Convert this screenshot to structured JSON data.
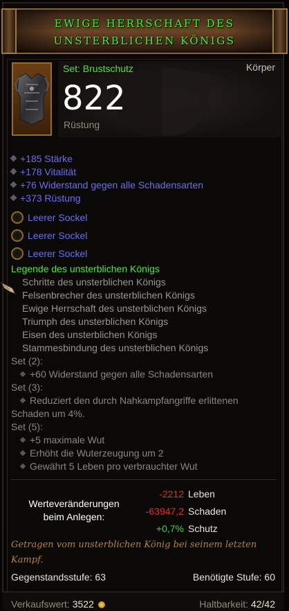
{
  "title": {
    "line1": "EWIGE HERRSCHAFT DES",
    "line2": "UNSTERBLICHEN KÖNIGS"
  },
  "item": {
    "type": "Set: Brustschutz",
    "slot": "Körper",
    "armor_value": "822",
    "armor_label": "Rüstung",
    "icon": "chest-armor-icon"
  },
  "stats": [
    "+185 Stärke",
    "+178 Vitalität",
    "+76 Widerstand gegen alle Schadensarten",
    "+373 Rüstung"
  ],
  "sockets": [
    "Leerer Sockel",
    "Leerer Sockel",
    "Leerer Sockel"
  ],
  "set": {
    "name": "Legende des unsterblichen Königs",
    "items": [
      "Schritte des unsterblichen Königs",
      "Felsenbrecher des unsterblichen Königs",
      "Ewige Herrschaft des unsterblichen Königs",
      "Triumph des unsterblichen Königs",
      "Eisen des unsterblichen Königs",
      "Stammesbindung des unsterblichen Königs"
    ],
    "bonus2_label": "Set (2):",
    "bonus2": [
      "+60 Widerstand gegen alle Schadensarten"
    ],
    "bonus3_label": "Set (3):",
    "bonus3_line1": "Reduziert den durch Nahkampfangriffe erlittenen",
    "bonus3_line2": "Schaden um 4%.",
    "bonus5_label": "Set (5):",
    "bonus5": [
      "+5 maximale Wut",
      "Erhöht die Wuterzeugung um 2",
      "Gewährt 5 Leben pro verbrauchter Wut"
    ]
  },
  "comparison": {
    "label_line1": "Werteveränderungen",
    "label_line2": "beim Anlegen:",
    "rows": [
      {
        "value": "-2212",
        "name": "Leben",
        "sign": "neg"
      },
      {
        "value": "-63947,2",
        "name": "Schaden",
        "sign": "neg"
      },
      {
        "value": "+0,7%",
        "name": "Schutz",
        "sign": "pos"
      }
    ],
    "colors": {
      "negative": "#e2312a",
      "positive": "#33d93a"
    }
  },
  "flavor": "Getragen vom unsterblichen König bei seinem letzten Kampf.",
  "item_level": "Gegenstandsstufe: 63",
  "required_level": "Benötigte Stufe: 60",
  "footer": {
    "sell_label": "Verkaufswert:",
    "sell_value": "3522",
    "durability_label": "Haltbarkeit:",
    "durability_value": "42/42"
  }
}
